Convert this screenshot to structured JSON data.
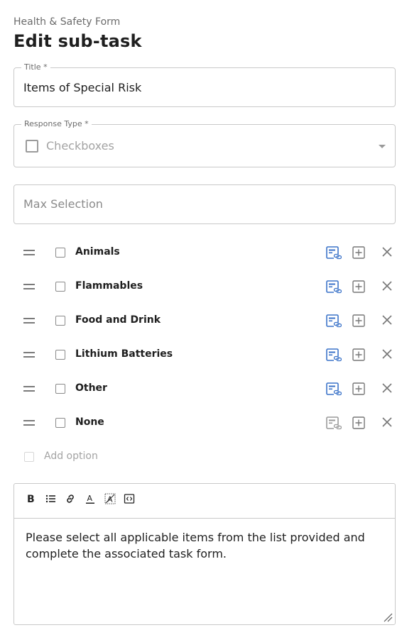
{
  "header": {
    "subtitle": "Health & Safety Form",
    "title": "Edit sub-task"
  },
  "form": {
    "title_field": {
      "label": "Title *",
      "value": "Items of Special Risk"
    },
    "response_type": {
      "label": "Response Type *",
      "value": "Checkboxes"
    },
    "max_selection": {
      "placeholder": "Max Selection"
    }
  },
  "options": [
    {
      "label": "Animals",
      "link_active": true
    },
    {
      "label": "Flammables",
      "link_active": true
    },
    {
      "label": "Food and Drink",
      "link_active": true
    },
    {
      "label": "Lithium Batteries",
      "link_active": true
    },
    {
      "label": "Other",
      "link_active": true
    },
    {
      "label": "None",
      "link_active": false
    }
  ],
  "add_option": {
    "label": "Add option"
  },
  "editor": {
    "toolbar": [
      "bold-icon",
      "bulleted-list-icon",
      "link-icon",
      "text-color-icon",
      "clear-format-icon",
      "source-code-icon"
    ],
    "content": "Please select all applicable items from the list provided and complete the associated task form."
  },
  "colors": {
    "accent": "#3b73c9",
    "inactive": "#9a9a9a",
    "border": "#c9c9c9"
  }
}
